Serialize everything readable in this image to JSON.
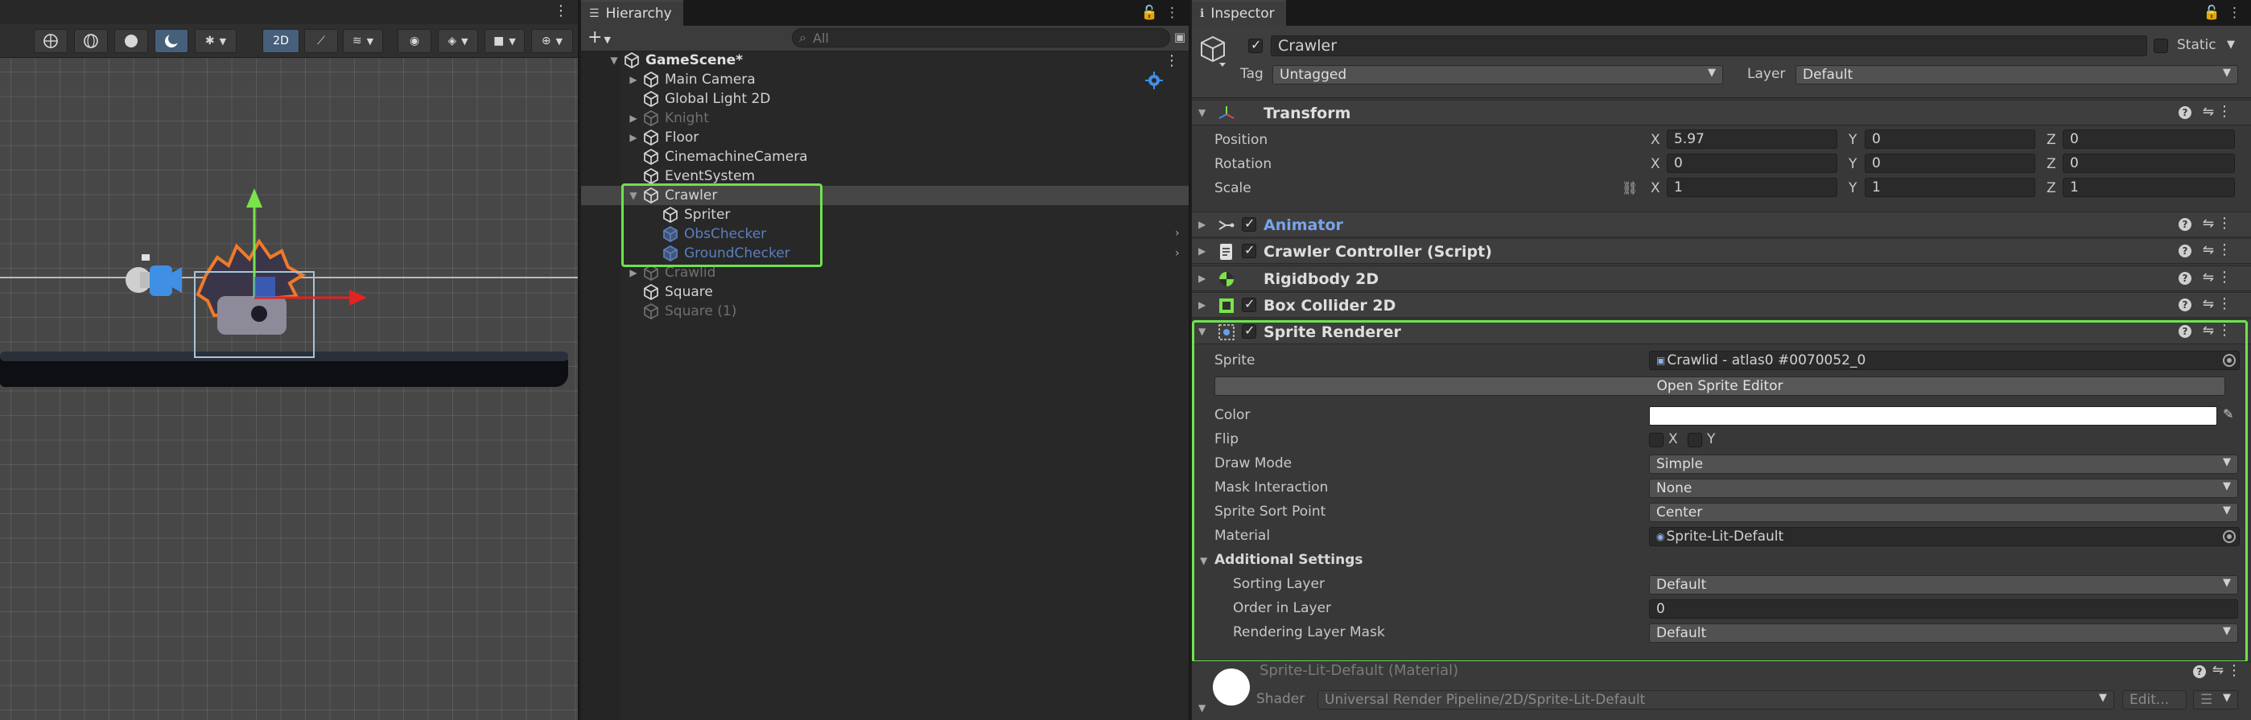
{
  "scene": {
    "toolbar": {
      "mode_2d": "2D"
    }
  },
  "hierarchy": {
    "tab_label": "Hierarchy",
    "add_label": "+",
    "search_placeholder": "All",
    "items": [
      {
        "label": "GameScene*",
        "kind": "scene"
      },
      {
        "label": "Main Camera",
        "kind": "normal"
      },
      {
        "label": "Global Light 2D",
        "kind": "normal"
      },
      {
        "label": "Knight",
        "kind": "dim"
      },
      {
        "label": "Floor",
        "kind": "normal"
      },
      {
        "label": "CinemachineCamera",
        "kind": "normal"
      },
      {
        "label": "EventSystem",
        "kind": "normal"
      },
      {
        "label": "Crawler",
        "kind": "selected"
      },
      {
        "label": "Spriter",
        "kind": "normal"
      },
      {
        "label": "ObsChecker",
        "kind": "prefab"
      },
      {
        "label": "GroundChecker",
        "kind": "prefab"
      },
      {
        "label": "Crawlid",
        "kind": "dim"
      },
      {
        "label": "Square",
        "kind": "normal"
      },
      {
        "label": "Square (1)",
        "kind": "dim"
      }
    ]
  },
  "inspector": {
    "tab_label": "Inspector",
    "object_name": "Crawler",
    "static_label": "Static",
    "tag_label": "Tag",
    "tag_value": "Untagged",
    "layer_label": "Layer",
    "layer_value": "Default",
    "transform": {
      "title": "Transform",
      "position_label": "Position",
      "rotation_label": "Rotation",
      "scale_label": "Scale",
      "position": {
        "x": "5.97",
        "y": "0",
        "z": "0"
      },
      "rotation": {
        "x": "0",
        "y": "0",
        "z": "0"
      },
      "scale": {
        "x": "1",
        "y": "1",
        "z": "1"
      },
      "axis_x": "X",
      "axis_y": "Y",
      "axis_z": "Z"
    },
    "components": {
      "animator": "Animator",
      "controller": "Crawler Controller (Script)",
      "rigidbody": "Rigidbody 2D",
      "collider": "Box Collider 2D",
      "sprite_renderer": "Sprite Renderer"
    },
    "sprite_renderer": {
      "sprite_label": "Sprite",
      "sprite_value": "Crawlid - atlas0 #0070052_0",
      "open_editor": "Open Sprite Editor",
      "color_label": "Color",
      "flip_label": "Flip",
      "flip_x": "X",
      "flip_y": "Y",
      "draw_mode_label": "Draw Mode",
      "draw_mode_value": "Simple",
      "mask_label": "Mask Interaction",
      "mask_value": "None",
      "sort_point_label": "Sprite Sort Point",
      "sort_point_value": "Center",
      "material_label": "Material",
      "material_value": "Sprite-Lit-Default",
      "additional_label": "Additional Settings",
      "sorting_layer_label": "Sorting Layer",
      "sorting_layer_value": "Default",
      "order_label": "Order in Layer",
      "order_value": "0",
      "rendering_mask_label": "Rendering Layer Mask",
      "rendering_mask_value": "Default"
    },
    "material": {
      "title": "Sprite-Lit-Default (Material)",
      "shader_label": "Shader",
      "shader_value": "Universal Render Pipeline/2D/Sprite-Lit-Default",
      "edit_label": "Edit..."
    }
  },
  "colors": {
    "highlight": "#6ee24d",
    "prefab_text": "#5a7fbe",
    "selected_row": "#464646"
  }
}
